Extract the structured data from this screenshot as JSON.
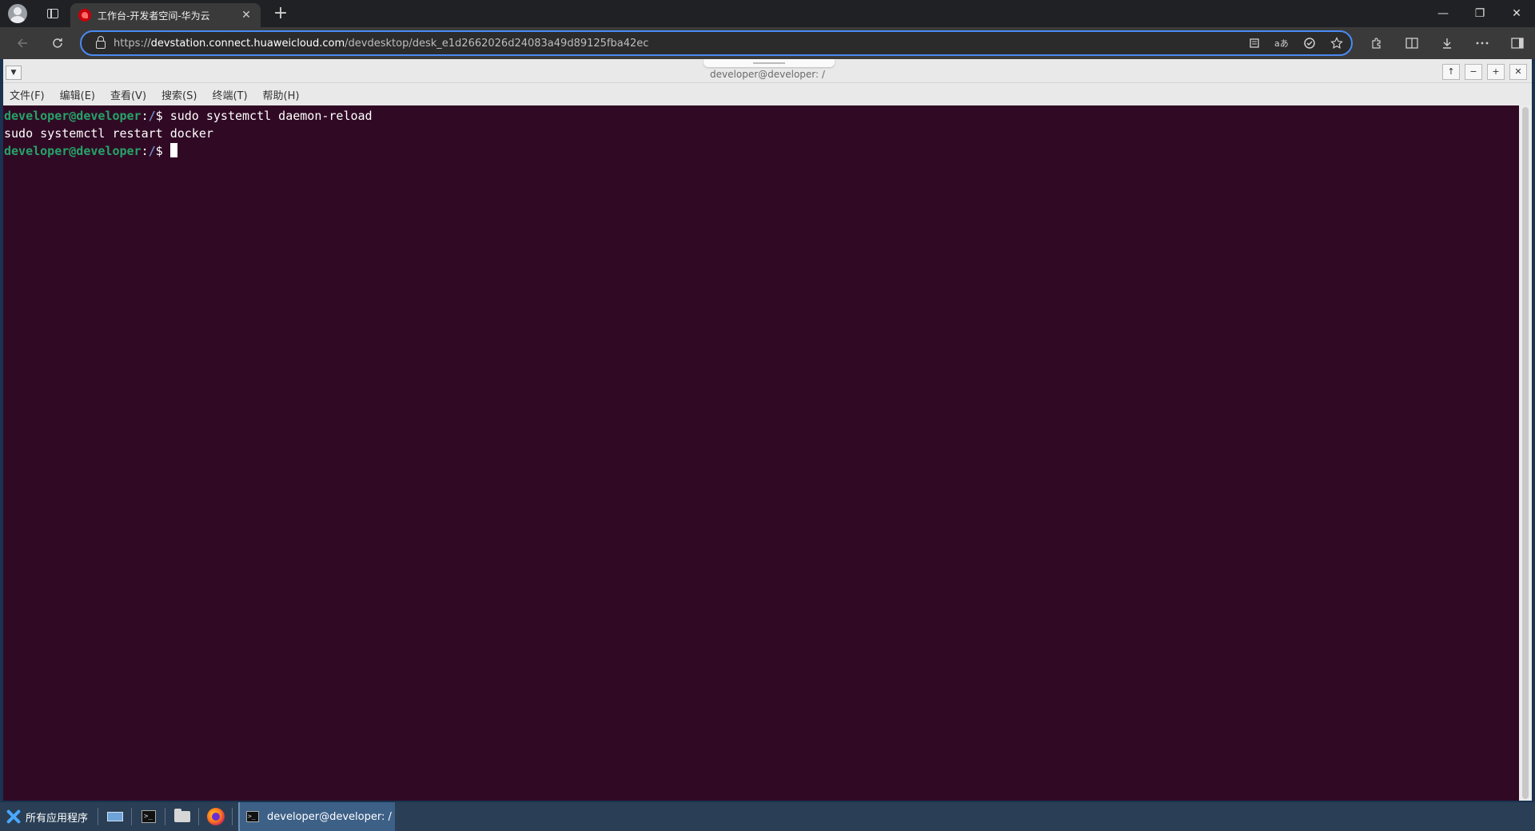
{
  "browser": {
    "tab_title": "工作台-开发者空间-华为云",
    "tab_close": "✕",
    "new_tab": "+",
    "url_prefix": "https://",
    "url_domain": "devstation.connect.huaweicloud.com",
    "url_path": "/devdesktop/desk_e1d2662026d24083a49d89125fba42ec",
    "window_controls": {
      "minimize": "—",
      "restore": "❐",
      "close": "✕"
    },
    "icons": [
      "profile-icon",
      "tab-actions-icon",
      "back-icon",
      "reload-icon",
      "lock-icon",
      "reading-mode-icon",
      "translate-icon",
      "refresh-page-icon",
      "favorite-icon",
      "extensions-icon",
      "split-screen-icon",
      "downloads-icon",
      "more-icon",
      "sidebar-icon"
    ]
  },
  "terminal_window": {
    "title": "developer@developer: /",
    "menu": [
      "文件(F)",
      "编辑(E)",
      "查看(V)",
      "搜索(S)",
      "终端(T)",
      "帮助(H)"
    ],
    "controls": {
      "up": "↑",
      "minimize": "−",
      "maximize": "+",
      "close": "✕"
    },
    "lines": [
      {
        "user": "developer@developer",
        "path": "/",
        "symbol": "$ ",
        "command": "sudo systemctl daemon-reload"
      },
      {
        "output": "sudo systemctl restart docker"
      },
      {
        "user": "developer@developer",
        "path": "/",
        "symbol": "$ ",
        "command": ""
      }
    ],
    "colors": {
      "background": "#300a24",
      "user": "#26a269",
      "path": "#6d8fcf",
      "text": "#ffffff"
    }
  },
  "taskbar": {
    "start_label": "所有应用程序",
    "task_item_label": "developer@developer: /",
    "terminal_glyph": ">_"
  }
}
